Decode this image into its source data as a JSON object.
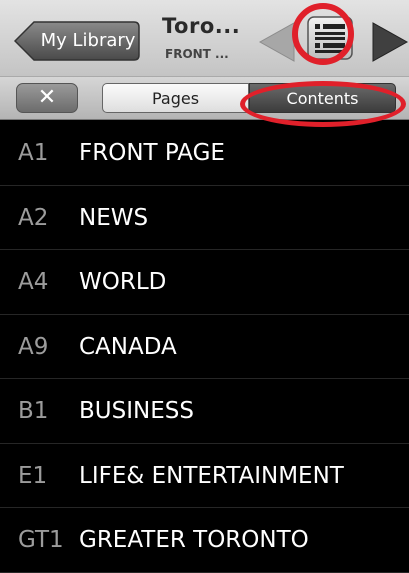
{
  "header": {
    "back_label": "My Library",
    "title": "Toro...",
    "subtitle": "FRONT ..."
  },
  "tabs": {
    "close_label": "✕",
    "pages_label": "Pages",
    "contents_label": "Contents",
    "selected": "Contents"
  },
  "sections": [
    {
      "code": "A1",
      "name": "FRONT PAGE"
    },
    {
      "code": "A2",
      "name": "NEWS"
    },
    {
      "code": "A4",
      "name": "WORLD"
    },
    {
      "code": "A9",
      "name": "CANADA"
    },
    {
      "code": "B1",
      "name": "BUSINESS"
    },
    {
      "code": "E1",
      "name": "LIFE& ENTERTAINMENT"
    },
    {
      "code": "GT1",
      "name": "GREATER TORONTO"
    }
  ],
  "colors": {
    "highlight": "#e0202a",
    "background": "#000000"
  }
}
